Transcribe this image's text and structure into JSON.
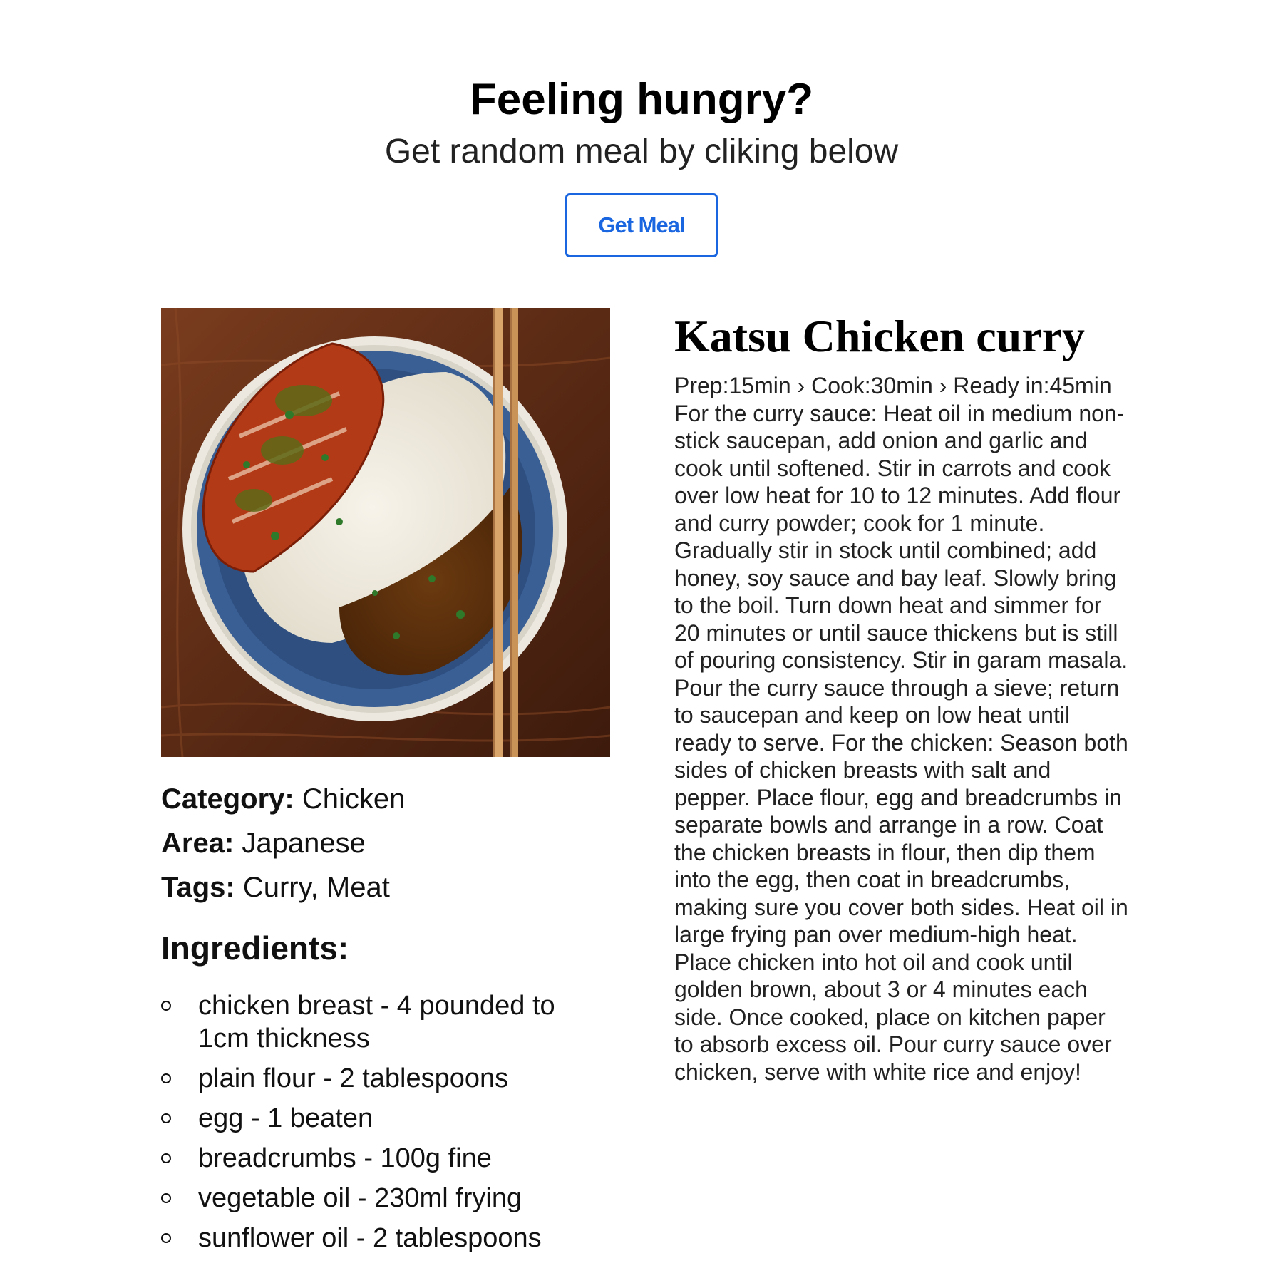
{
  "hero": {
    "title": "Feeling hungry?",
    "subtitle": "Get random meal by cliking below",
    "button_label": "Get Meal"
  },
  "meal": {
    "name": "Katsu Chicken curry",
    "timing": "Prep:15min › Cook:30min › Ready in:45min",
    "instructions": "For the curry sauce: Heat oil in medium non-stick saucepan, add onion and garlic and cook until softened. Stir in carrots and cook over low heat for 10 to 12 minutes. Add flour and curry powder; cook for 1 minute. Gradually stir in stock until combined; add honey, soy sauce and bay leaf. Slowly bring to the boil. Turn down heat and simmer for 20 minutes or until sauce thickens but is still of pouring consistency. Stir in garam masala. Pour the curry sauce through a sieve; return to saucepan and keep on low heat until ready to serve. For the chicken: Season both sides of chicken breasts with salt and pepper. Place flour, egg and breadcrumbs in separate bowls and arrange in a row. Coat the chicken breasts in flour, then dip them into the egg, then coat in breadcrumbs, making sure you cover both sides. Heat oil in large frying pan over medium-high heat. Place chicken into hot oil and cook until golden brown, about 3 or 4 minutes each side. Once cooked, place on kitchen paper to absorb excess oil. Pour curry sauce over chicken, serve with white rice and enjoy!",
    "category_label": "Category:",
    "category": "Chicken",
    "area_label": "Area:",
    "area": "Japanese",
    "tags_label": "Tags:",
    "tags": "Curry, Meat",
    "ingredients_title": "Ingredients:",
    "ingredients": [
      "chicken breast - 4 pounded to 1cm thickness",
      "plain flour - 2 tablespoons",
      "egg - 1 beaten",
      "breadcrumbs - 100g fine",
      "vegetable oil - 230ml frying",
      "sunflower oil - 2 tablespoons"
    ]
  },
  "colors": {
    "accent": "#1a66e0",
    "text": "#111111",
    "background": "#ffffff"
  },
  "icons": {
    "bullet": "hollow-circle"
  }
}
